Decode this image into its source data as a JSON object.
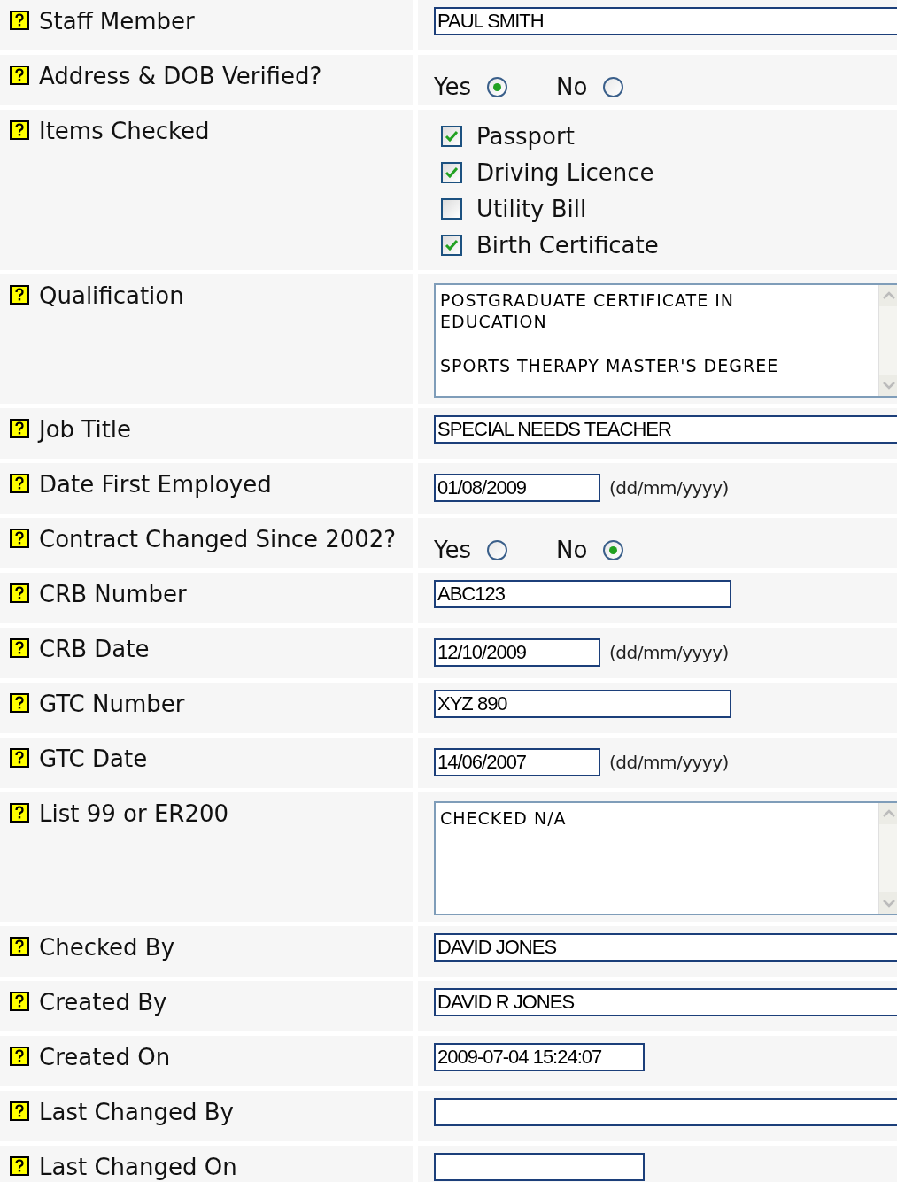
{
  "fields": [
    {
      "label": "Staff Member",
      "kind": "wide_text",
      "value": "PAUL SMITH"
    },
    {
      "label": "Address & DOB Verified?",
      "kind": "radio",
      "options": [
        {
          "label": "Yes",
          "selected": true
        },
        {
          "label": "No",
          "selected": false
        }
      ]
    },
    {
      "label": "Items Checked",
      "kind": "checkboxes",
      "options": [
        {
          "label": "Passport",
          "checked": true
        },
        {
          "label": "Driving Licence",
          "checked": true
        },
        {
          "label": "Utility Bill",
          "checked": false
        },
        {
          "label": "Birth Certificate",
          "checked": true
        }
      ]
    },
    {
      "label": "Qualification",
      "kind": "textarea",
      "paragraphs": [
        [
          "POSTGRADUATE CERTIFICATE IN",
          "EDUCATION"
        ],
        [
          "SPORTS THERAPY MASTER'S DEGREE"
        ]
      ]
    },
    {
      "label": "Job Title",
      "kind": "wide_text",
      "value": "SPECIAL NEEDS TEACHER"
    },
    {
      "label": "Date First Employed",
      "kind": "date",
      "value": "01/08/2009",
      "hint": "(dd/mm/yyyy)"
    },
    {
      "label": "Contract Changed Since 2002?",
      "kind": "radio",
      "options": [
        {
          "label": "Yes",
          "selected": false
        },
        {
          "label": "No",
          "selected": true
        }
      ]
    },
    {
      "label": "CRB Number",
      "kind": "code_text",
      "value": "ABC123"
    },
    {
      "label": "CRB Date",
      "kind": "date",
      "value": "12/10/2009",
      "hint": "(dd/mm/yyyy)"
    },
    {
      "label": "GTC Number",
      "kind": "code_text",
      "value": "XYZ 890"
    },
    {
      "label": "GTC Date",
      "kind": "date",
      "value": "14/06/2007",
      "hint": "(dd/mm/yyyy)"
    },
    {
      "label": "List 99 or ER200",
      "kind": "textarea",
      "paragraphs": [
        [
          "CHECKED N/A"
        ]
      ]
    },
    {
      "label": "Checked By",
      "kind": "wide_text",
      "value": "DAVID JONES"
    },
    {
      "label": "Created By",
      "kind": "wide_text",
      "value": "DAVID R JONES"
    },
    {
      "label": "Created On",
      "kind": "datetime",
      "value": "2009-07-04 15:24:07"
    },
    {
      "label": "Last Changed By",
      "kind": "wide_text"
    },
    {
      "label": "Last Changed On",
      "kind": "datetime"
    }
  ]
}
